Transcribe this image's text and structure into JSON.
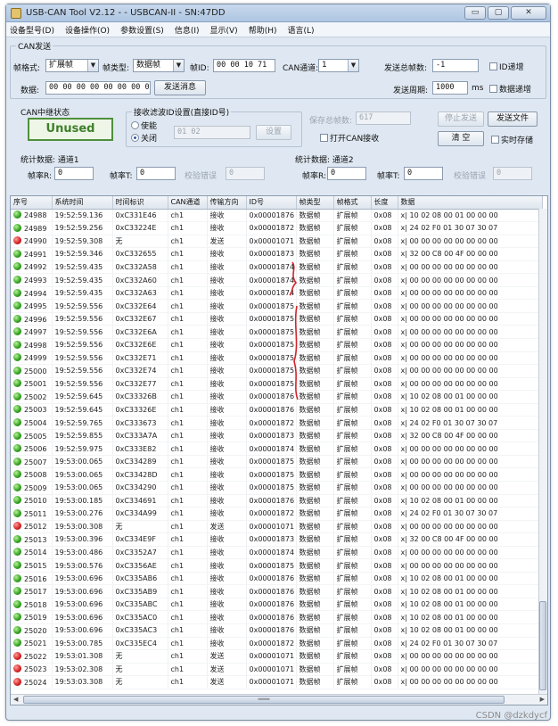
{
  "window": {
    "title": "USB-CAN Tool V2.12 - - USBCAN-II - SN:47DD",
    "min_glyph": "▭",
    "max_glyph": "▢",
    "close_glyph": "✕"
  },
  "menu": [
    "设备型号(D)",
    "设备操作(O)",
    "参数设置(S)",
    "信息(I)",
    "显示(V)",
    "帮助(H)",
    "语言(L)"
  ],
  "send": {
    "group_title": "CAN发送",
    "frame_format_label": "帧格式:",
    "frame_format_value": "扩展帧",
    "frame_type_label": "帧类型:",
    "frame_type_value": "数据帧",
    "frame_id_label": "帧ID:",
    "frame_id_value": "00 00 10 71",
    "can_channel_label": "CAN通道:",
    "can_channel_value": "1",
    "total_frames_label": "发送总帧数:",
    "total_frames_value": "-1",
    "id_increment_label": "ID递增",
    "data_label": "数据:",
    "data_value": "00 00 00 00 00 00 00 00",
    "send_message_button": "发送消息",
    "period_label": "发送周期:",
    "period_value": "1000",
    "period_unit": "ms",
    "data_increment_label": "数据递增"
  },
  "bus_status": {
    "label": "CAN中继状态",
    "value": "Unused"
  },
  "filter": {
    "label": "接收滤波ID设置(直接ID号)",
    "enable_label": "使能",
    "close_label": "关闭",
    "id_value": "01 02",
    "set_button": "设置"
  },
  "save": {
    "total_frames_label": "保存总帧数:",
    "total_frames_value": "617",
    "open_can_recv_label": "打开CAN接收",
    "stop_send_button": "停止发送",
    "send_file_button": "发送文件",
    "clear_button": "清 空",
    "realtime_save_label": "实时存储"
  },
  "stats": [
    {
      "title": "统计数据: 通道1",
      "rx_label": "帧率R:",
      "rx_value": "0",
      "tx_label": "帧率T:",
      "tx_value": "0",
      "err_label": "校验错误",
      "err_value": "0"
    },
    {
      "title": "统计数据: 通道2",
      "rx_label": "帧率R:",
      "rx_value": "0",
      "tx_label": "帧率T:",
      "tx_value": "0",
      "err_label": "校验错误",
      "err_value": "0"
    }
  ],
  "table": {
    "columns": [
      "序号",
      "系统时间",
      "时间标识",
      "CAN通道",
      "传输方向",
      "ID号",
      "帧类型",
      "帧格式",
      "长度",
      "数据"
    ],
    "rows": [
      {
        "status": "ok",
        "seq": "24988",
        "time": "19:52:59.136",
        "stamp": "0xC331E46",
        "ch": "ch1",
        "dir": "接收",
        "id": "0x00001876",
        "ftype": "数据帧",
        "fmt": "扩展帧",
        "len": "0x08",
        "data": "x| 10 02 08 00 01 00 00 00"
      },
      {
        "status": "ok",
        "seq": "24989",
        "time": "19:52:59.256",
        "stamp": "0xC33224E",
        "ch": "ch1",
        "dir": "接收",
        "id": "0x00001872",
        "ftype": "数据帧",
        "fmt": "扩展帧",
        "len": "0x08",
        "data": "x| 24 02 F0 01 30 07 30 07"
      },
      {
        "status": "err",
        "seq": "24990",
        "time": "19:52:59.308",
        "stamp": "无",
        "ch": "ch1",
        "dir": "发送",
        "id": "0x00001071",
        "ftype": "数据帧",
        "fmt": "扩展帧",
        "len": "0x08",
        "data": "x| 00 00 00 00 00 00 00 00"
      },
      {
        "status": "ok",
        "seq": "24991",
        "time": "19:52:59.346",
        "stamp": "0xC332655",
        "ch": "ch1",
        "dir": "接收",
        "id": "0x00001873",
        "ftype": "数据帧",
        "fmt": "扩展帧",
        "len": "0x08",
        "data": "x| 32 00 C8 00 4F 00 00 00"
      },
      {
        "status": "ok",
        "seq": "24992",
        "time": "19:52:59.435",
        "stamp": "0xC332A58",
        "ch": "ch1",
        "dir": "接收",
        "id": "0x00001874",
        "ftype": "数据帧",
        "fmt": "扩展帧",
        "len": "0x08",
        "data": "x| 00 00 00 00 00 00 00 00"
      },
      {
        "status": "ok",
        "seq": "24993",
        "time": "19:52:59.435",
        "stamp": "0xC332A60",
        "ch": "ch1",
        "dir": "接收",
        "id": "0x00001874",
        "ftype": "数据帧",
        "fmt": "扩展帧",
        "len": "0x08",
        "data": "x| 00 00 00 00 00 00 00 00"
      },
      {
        "status": "ok",
        "seq": "24994",
        "time": "19:52:59.435",
        "stamp": "0xC332A63",
        "ch": "ch1",
        "dir": "接收",
        "id": "0x00001874",
        "ftype": "数据帧",
        "fmt": "扩展帧",
        "len": "0x08",
        "data": "x| 00 00 00 00 00 00 00 00"
      },
      {
        "status": "ok",
        "seq": "24995",
        "time": "19:52:59.556",
        "stamp": "0xC332E64",
        "ch": "ch1",
        "dir": "接收",
        "id": "0x00001875",
        "ftype": "数据帧",
        "fmt": "扩展帧",
        "len": "0x08",
        "data": "x| 00 00 00 00 00 00 00 00"
      },
      {
        "status": "ok",
        "seq": "24996",
        "time": "19:52:59.556",
        "stamp": "0xC332E67",
        "ch": "ch1",
        "dir": "接收",
        "id": "0x00001875",
        "ftype": "数据帧",
        "fmt": "扩展帧",
        "len": "0x08",
        "data": "x| 00 00 00 00 00 00 00 00"
      },
      {
        "status": "ok",
        "seq": "24997",
        "time": "19:52:59.556",
        "stamp": "0xC332E6A",
        "ch": "ch1",
        "dir": "接收",
        "id": "0x00001875",
        "ftype": "数据帧",
        "fmt": "扩展帧",
        "len": "0x08",
        "data": "x| 00 00 00 00 00 00 00 00"
      },
      {
        "status": "ok",
        "seq": "24998",
        "time": "19:52:59.556",
        "stamp": "0xC332E6E",
        "ch": "ch1",
        "dir": "接收",
        "id": "0x00001875",
        "ftype": "数据帧",
        "fmt": "扩展帧",
        "len": "0x08",
        "data": "x| 00 00 00 00 00 00 00 00"
      },
      {
        "status": "ok",
        "seq": "24999",
        "time": "19:52:59.556",
        "stamp": "0xC332E71",
        "ch": "ch1",
        "dir": "接收",
        "id": "0x00001875",
        "ftype": "数据帧",
        "fmt": "扩展帧",
        "len": "0x08",
        "data": "x| 00 00 00 00 00 00 00 00"
      },
      {
        "status": "ok",
        "seq": "25000",
        "time": "19:52:59.556",
        "stamp": "0xC332E74",
        "ch": "ch1",
        "dir": "接收",
        "id": "0x00001875",
        "ftype": "数据帧",
        "fmt": "扩展帧",
        "len": "0x08",
        "data": "x| 00 00 00 00 00 00 00 00"
      },
      {
        "status": "ok",
        "seq": "25001",
        "time": "19:52:59.556",
        "stamp": "0xC332E77",
        "ch": "ch1",
        "dir": "接收",
        "id": "0x00001875",
        "ftype": "数据帧",
        "fmt": "扩展帧",
        "len": "0x08",
        "data": "x| 00 00 00 00 00 00 00 00"
      },
      {
        "status": "ok",
        "seq": "25002",
        "time": "19:52:59.645",
        "stamp": "0xC33326B",
        "ch": "ch1",
        "dir": "接收",
        "id": "0x00001876",
        "ftype": "数据帧",
        "fmt": "扩展帧",
        "len": "0x08",
        "data": "x| 10 02 08 00 01 00 00 00"
      },
      {
        "status": "ok",
        "seq": "25003",
        "time": "19:52:59.645",
        "stamp": "0xC33326E",
        "ch": "ch1",
        "dir": "接收",
        "id": "0x00001876",
        "ftype": "数据帧",
        "fmt": "扩展帧",
        "len": "0x08",
        "data": "x| 10 02 08 00 01 00 00 00"
      },
      {
        "status": "ok",
        "seq": "25004",
        "time": "19:52:59.765",
        "stamp": "0xC333673",
        "ch": "ch1",
        "dir": "接收",
        "id": "0x00001872",
        "ftype": "数据帧",
        "fmt": "扩展帧",
        "len": "0x08",
        "data": "x| 24 02 F0 01 30 07 30 07"
      },
      {
        "status": "ok",
        "seq": "25005",
        "time": "19:52:59.855",
        "stamp": "0xC333A7A",
        "ch": "ch1",
        "dir": "接收",
        "id": "0x00001873",
        "ftype": "数据帧",
        "fmt": "扩展帧",
        "len": "0x08",
        "data": "x| 32 00 C8 00 4F 00 00 00"
      },
      {
        "status": "ok",
        "seq": "25006",
        "time": "19:52:59.975",
        "stamp": "0xC333E82",
        "ch": "ch1",
        "dir": "接收",
        "id": "0x00001874",
        "ftype": "数据帧",
        "fmt": "扩展帧",
        "len": "0x08",
        "data": "x| 00 00 00 00 00 00 00 00"
      },
      {
        "status": "ok",
        "seq": "25007",
        "time": "19:53:00.065",
        "stamp": "0xC334289",
        "ch": "ch1",
        "dir": "接收",
        "id": "0x00001875",
        "ftype": "数据帧",
        "fmt": "扩展帧",
        "len": "0x08",
        "data": "x| 00 00 00 00 00 00 00 00"
      },
      {
        "status": "ok",
        "seq": "25008",
        "time": "19:53:00.065",
        "stamp": "0xC33428D",
        "ch": "ch1",
        "dir": "接收",
        "id": "0x00001875",
        "ftype": "数据帧",
        "fmt": "扩展帧",
        "len": "0x08",
        "data": "x| 00 00 00 00 00 00 00 00"
      },
      {
        "status": "ok",
        "seq": "25009",
        "time": "19:53:00.065",
        "stamp": "0xC334290",
        "ch": "ch1",
        "dir": "接收",
        "id": "0x00001875",
        "ftype": "数据帧",
        "fmt": "扩展帧",
        "len": "0x08",
        "data": "x| 00 00 00 00 00 00 00 00"
      },
      {
        "status": "ok",
        "seq": "25010",
        "time": "19:53:00.185",
        "stamp": "0xC334691",
        "ch": "ch1",
        "dir": "接收",
        "id": "0x00001876",
        "ftype": "数据帧",
        "fmt": "扩展帧",
        "len": "0x08",
        "data": "x| 10 02 08 00 01 00 00 00"
      },
      {
        "status": "ok",
        "seq": "25011",
        "time": "19:53:00.276",
        "stamp": "0xC334A99",
        "ch": "ch1",
        "dir": "接收",
        "id": "0x00001872",
        "ftype": "数据帧",
        "fmt": "扩展帧",
        "len": "0x08",
        "data": "x| 24 02 F0 01 30 07 30 07"
      },
      {
        "status": "err",
        "seq": "25012",
        "time": "19:53:00.308",
        "stamp": "无",
        "ch": "ch1",
        "dir": "发送",
        "id": "0x00001071",
        "ftype": "数据帧",
        "fmt": "扩展帧",
        "len": "0x08",
        "data": "x| 00 00 00 00 00 00 00 00"
      },
      {
        "status": "ok",
        "seq": "25013",
        "time": "19:53:00.396",
        "stamp": "0xC334E9F",
        "ch": "ch1",
        "dir": "接收",
        "id": "0x00001873",
        "ftype": "数据帧",
        "fmt": "扩展帧",
        "len": "0x08",
        "data": "x| 32 00 C8 00 4F 00 00 00"
      },
      {
        "status": "ok",
        "seq": "25014",
        "time": "19:53:00.486",
        "stamp": "0xC3352A7",
        "ch": "ch1",
        "dir": "接收",
        "id": "0x00001874",
        "ftype": "数据帧",
        "fmt": "扩展帧",
        "len": "0x08",
        "data": "x| 00 00 00 00 00 00 00 00"
      },
      {
        "status": "ok",
        "seq": "25015",
        "time": "19:53:00.576",
        "stamp": "0xC3356AE",
        "ch": "ch1",
        "dir": "接收",
        "id": "0x00001875",
        "ftype": "数据帧",
        "fmt": "扩展帧",
        "len": "0x08",
        "data": "x| 00 00 00 00 00 00 00 00"
      },
      {
        "status": "ok",
        "seq": "25016",
        "time": "19:53:00.696",
        "stamp": "0xC335AB6",
        "ch": "ch1",
        "dir": "接收",
        "id": "0x00001876",
        "ftype": "数据帧",
        "fmt": "扩展帧",
        "len": "0x08",
        "data": "x| 10 02 08 00 01 00 00 00"
      },
      {
        "status": "ok",
        "seq": "25017",
        "time": "19:53:00.696",
        "stamp": "0xC335AB9",
        "ch": "ch1",
        "dir": "接收",
        "id": "0x00001876",
        "ftype": "数据帧",
        "fmt": "扩展帧",
        "len": "0x08",
        "data": "x| 10 02 08 00 01 00 00 00"
      },
      {
        "status": "ok",
        "seq": "25018",
        "time": "19:53:00.696",
        "stamp": "0xC335ABC",
        "ch": "ch1",
        "dir": "接收",
        "id": "0x00001876",
        "ftype": "数据帧",
        "fmt": "扩展帧",
        "len": "0x08",
        "data": "x| 10 02 08 00 01 00 00 00"
      },
      {
        "status": "ok",
        "seq": "25019",
        "time": "19:53:00.696",
        "stamp": "0xC335AC0",
        "ch": "ch1",
        "dir": "接收",
        "id": "0x00001876",
        "ftype": "数据帧",
        "fmt": "扩展帧",
        "len": "0x08",
        "data": "x| 10 02 08 00 01 00 00 00"
      },
      {
        "status": "ok",
        "seq": "25020",
        "time": "19:53:00.696",
        "stamp": "0xC335AC3",
        "ch": "ch1",
        "dir": "接收",
        "id": "0x00001876",
        "ftype": "数据帧",
        "fmt": "扩展帧",
        "len": "0x08",
        "data": "x| 10 02 08 00 01 00 00 00"
      },
      {
        "status": "ok",
        "seq": "25021",
        "time": "19:53:00.785",
        "stamp": "0xC335EC4",
        "ch": "ch1",
        "dir": "接收",
        "id": "0x00001872",
        "ftype": "数据帧",
        "fmt": "扩展帧",
        "len": "0x08",
        "data": "x| 24 02 F0 01 30 07 30 07"
      },
      {
        "status": "err",
        "seq": "25022",
        "time": "19:53:01.308",
        "stamp": "无",
        "ch": "ch1",
        "dir": "发送",
        "id": "0x00001071",
        "ftype": "数据帧",
        "fmt": "扩展帧",
        "len": "0x08",
        "data": "x| 00 00 00 00 00 00 00 00"
      },
      {
        "status": "err",
        "seq": "25023",
        "time": "19:53:02.308",
        "stamp": "无",
        "ch": "ch1",
        "dir": "发送",
        "id": "0x00001071",
        "ftype": "数据帧",
        "fmt": "扩展帧",
        "len": "0x08",
        "data": "x| 00 00 00 00 00 00 00 00"
      },
      {
        "status": "err",
        "seq": "25024",
        "time": "19:53:03.308",
        "stamp": "无",
        "ch": "ch1",
        "dir": "发送",
        "id": "0x00001071",
        "ftype": "数据帧",
        "fmt": "扩展帧",
        "len": "0x08",
        "data": "x| 00 00 00 00 00 00 00 00"
      }
    ]
  },
  "scrollbar": {
    "grip": "═══"
  },
  "watermark": "CSDN @dzkdycf",
  "colors": {
    "led_ok": "#2f9d1c",
    "led_err": "#d21d1d",
    "status_green": "#3f7f2a",
    "annotation_red": "#d3232a"
  }
}
